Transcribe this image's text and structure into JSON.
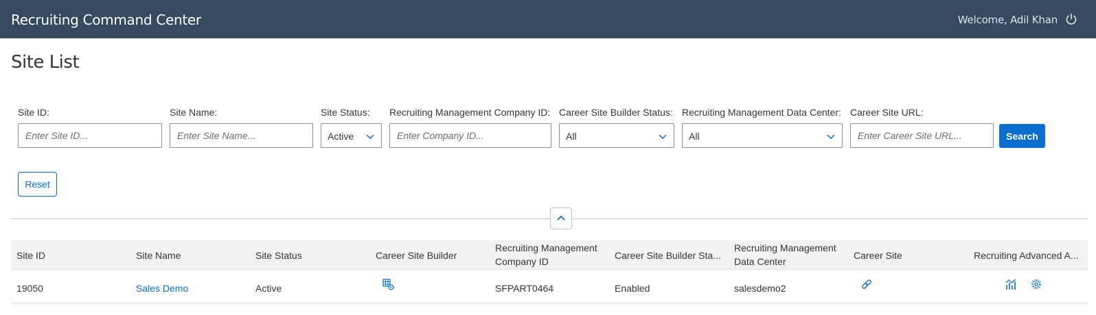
{
  "header": {
    "app_title": "Recruiting Command Center",
    "welcome_text": "Welcome, Adil Khan",
    "power_icon": "power-icon"
  },
  "page": {
    "title": "Site List"
  },
  "filters": {
    "site_id": {
      "label": "Site ID:",
      "placeholder": "Enter Site ID...",
      "value": ""
    },
    "site_name": {
      "label": "Site Name:",
      "placeholder": "Enter Site Name...",
      "value": ""
    },
    "site_status": {
      "label": "Site Status:",
      "value": "Active"
    },
    "company_id": {
      "label": "Recruiting Management Company ID:",
      "placeholder": "Enter Company ID...",
      "value": ""
    },
    "builder_status": {
      "label": "Career Site Builder Status:",
      "value": "All"
    },
    "data_center": {
      "label": "Recruiting Management Data Center:",
      "value": "All"
    },
    "career_url": {
      "label": "Career Site URL:",
      "placeholder": "Enter Career Site URL...",
      "value": ""
    },
    "search_label": "Search",
    "reset_label": "Reset"
  },
  "table": {
    "columns": {
      "site_id": "Site ID",
      "site_name": "Site Name",
      "site_status": "Site Status",
      "career_site_builder": "Career Site Builder",
      "rm_company_id": "Recruiting Management Company ID",
      "builder_status": "Career Site Builder Sta...",
      "rm_data_center": "Recruiting Management Data Center",
      "career_site": "Career Site",
      "recruiting_advanced": "Recruiting Advanced A..."
    },
    "rows": [
      {
        "site_id": "19050",
        "site_name": "Sales Demo",
        "site_status": "Active",
        "career_site_builder_icon": "site-builder-icon",
        "rm_company_id": "SFPART0464",
        "builder_status": "Enabled",
        "rm_data_center": "salesdemo2",
        "career_site_icon": "link-icon",
        "advanced_icons": [
          "analytics-icon",
          "settings-icon"
        ]
      }
    ]
  },
  "colors": {
    "shell": "#354a5f",
    "accent": "#0a6ed1",
    "header_row": "#f2f2f2",
    "text": "#32363a"
  }
}
